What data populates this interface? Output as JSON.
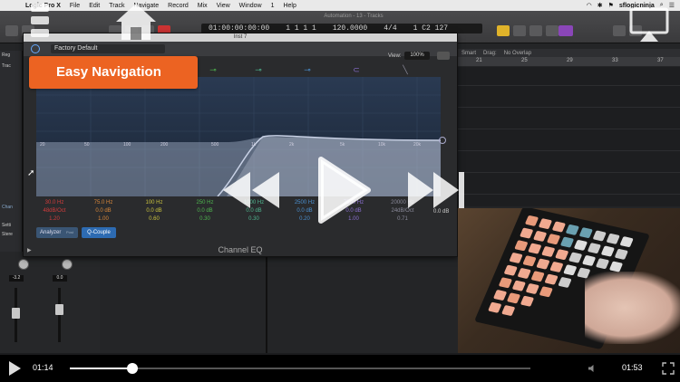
{
  "menubar": {
    "app": "Logic Pro X",
    "items": [
      "File",
      "Edit",
      "Track",
      "Navigate",
      "Record",
      "Mix",
      "View",
      "Window",
      "1",
      "Help"
    ],
    "user": "sflogicninja"
  },
  "lcd": {
    "window_title": "Automation - 13 - Tracks",
    "time": "01:00:00:00:00",
    "bars": "1  1  1    1",
    "tempo": "120.0000",
    "signature": "4/4",
    "key": "1 C2 127"
  },
  "track_toolbar": {
    "snap": "Smart",
    "drag_label": "Drag:",
    "drag_value": "No Overlap"
  },
  "ruler_marks": [
    "21",
    "25",
    "29",
    "33",
    "37"
  ],
  "left_labels": [
    "Reg",
    "Trac",
    "Chan",
    "Setti",
    "Stere"
  ],
  "mixer": {
    "vol_a": "-3.2",
    "vol_b": "0.0"
  },
  "eq": {
    "window_title": "Inst 7",
    "preset": "Factory Default",
    "view_label": "View:",
    "view_value": "100%",
    "freq_axis": [
      "20",
      "50",
      "100",
      "200",
      "500",
      "1k",
      "2k",
      "5k",
      "10k",
      "20k"
    ],
    "params": [
      {
        "freq": "30.0 Hz",
        "gain": "48dB/Oct",
        "q": "1.20",
        "color": "#d33c3c"
      },
      {
        "freq": "75.0 Hz",
        "gain": "0.0 dB",
        "q": "1.00",
        "color": "#d9873a"
      },
      {
        "freq": "100 Hz",
        "gain": "0.0 dB",
        "q": "0.60",
        "color": "#c9c23e"
      },
      {
        "freq": "250 Hz",
        "gain": "0.0 dB",
        "q": "0.30",
        "color": "#4fb54f"
      },
      {
        "freq": "1000 Hz",
        "gain": "0.0 dB",
        "q": "0.30",
        "color": "#4fb58f"
      },
      {
        "freq": "2500 Hz",
        "gain": "0.0 dB",
        "q": "0.20",
        "color": "#4a8fcf"
      },
      {
        "freq": "7500 Hz",
        "gain": "0.0 dB",
        "q": "1.00",
        "color": "#8a6fd0"
      },
      {
        "freq": "20000 Hz",
        "gain": "24dB/Oct",
        "q": "0.71",
        "color": "#8a8a9a"
      }
    ],
    "output_db": "0.0 dB",
    "analyzer_label": "Analyzer",
    "analyzer_mode": "Post",
    "qcouple_label": "Q-Couple",
    "footer": "Channel EQ"
  },
  "callout": {
    "text": "Easy Navigation",
    "color": "#ec6322"
  },
  "player": {
    "current_time": "01:14",
    "total_time": "01:53",
    "progress": 0.135
  }
}
